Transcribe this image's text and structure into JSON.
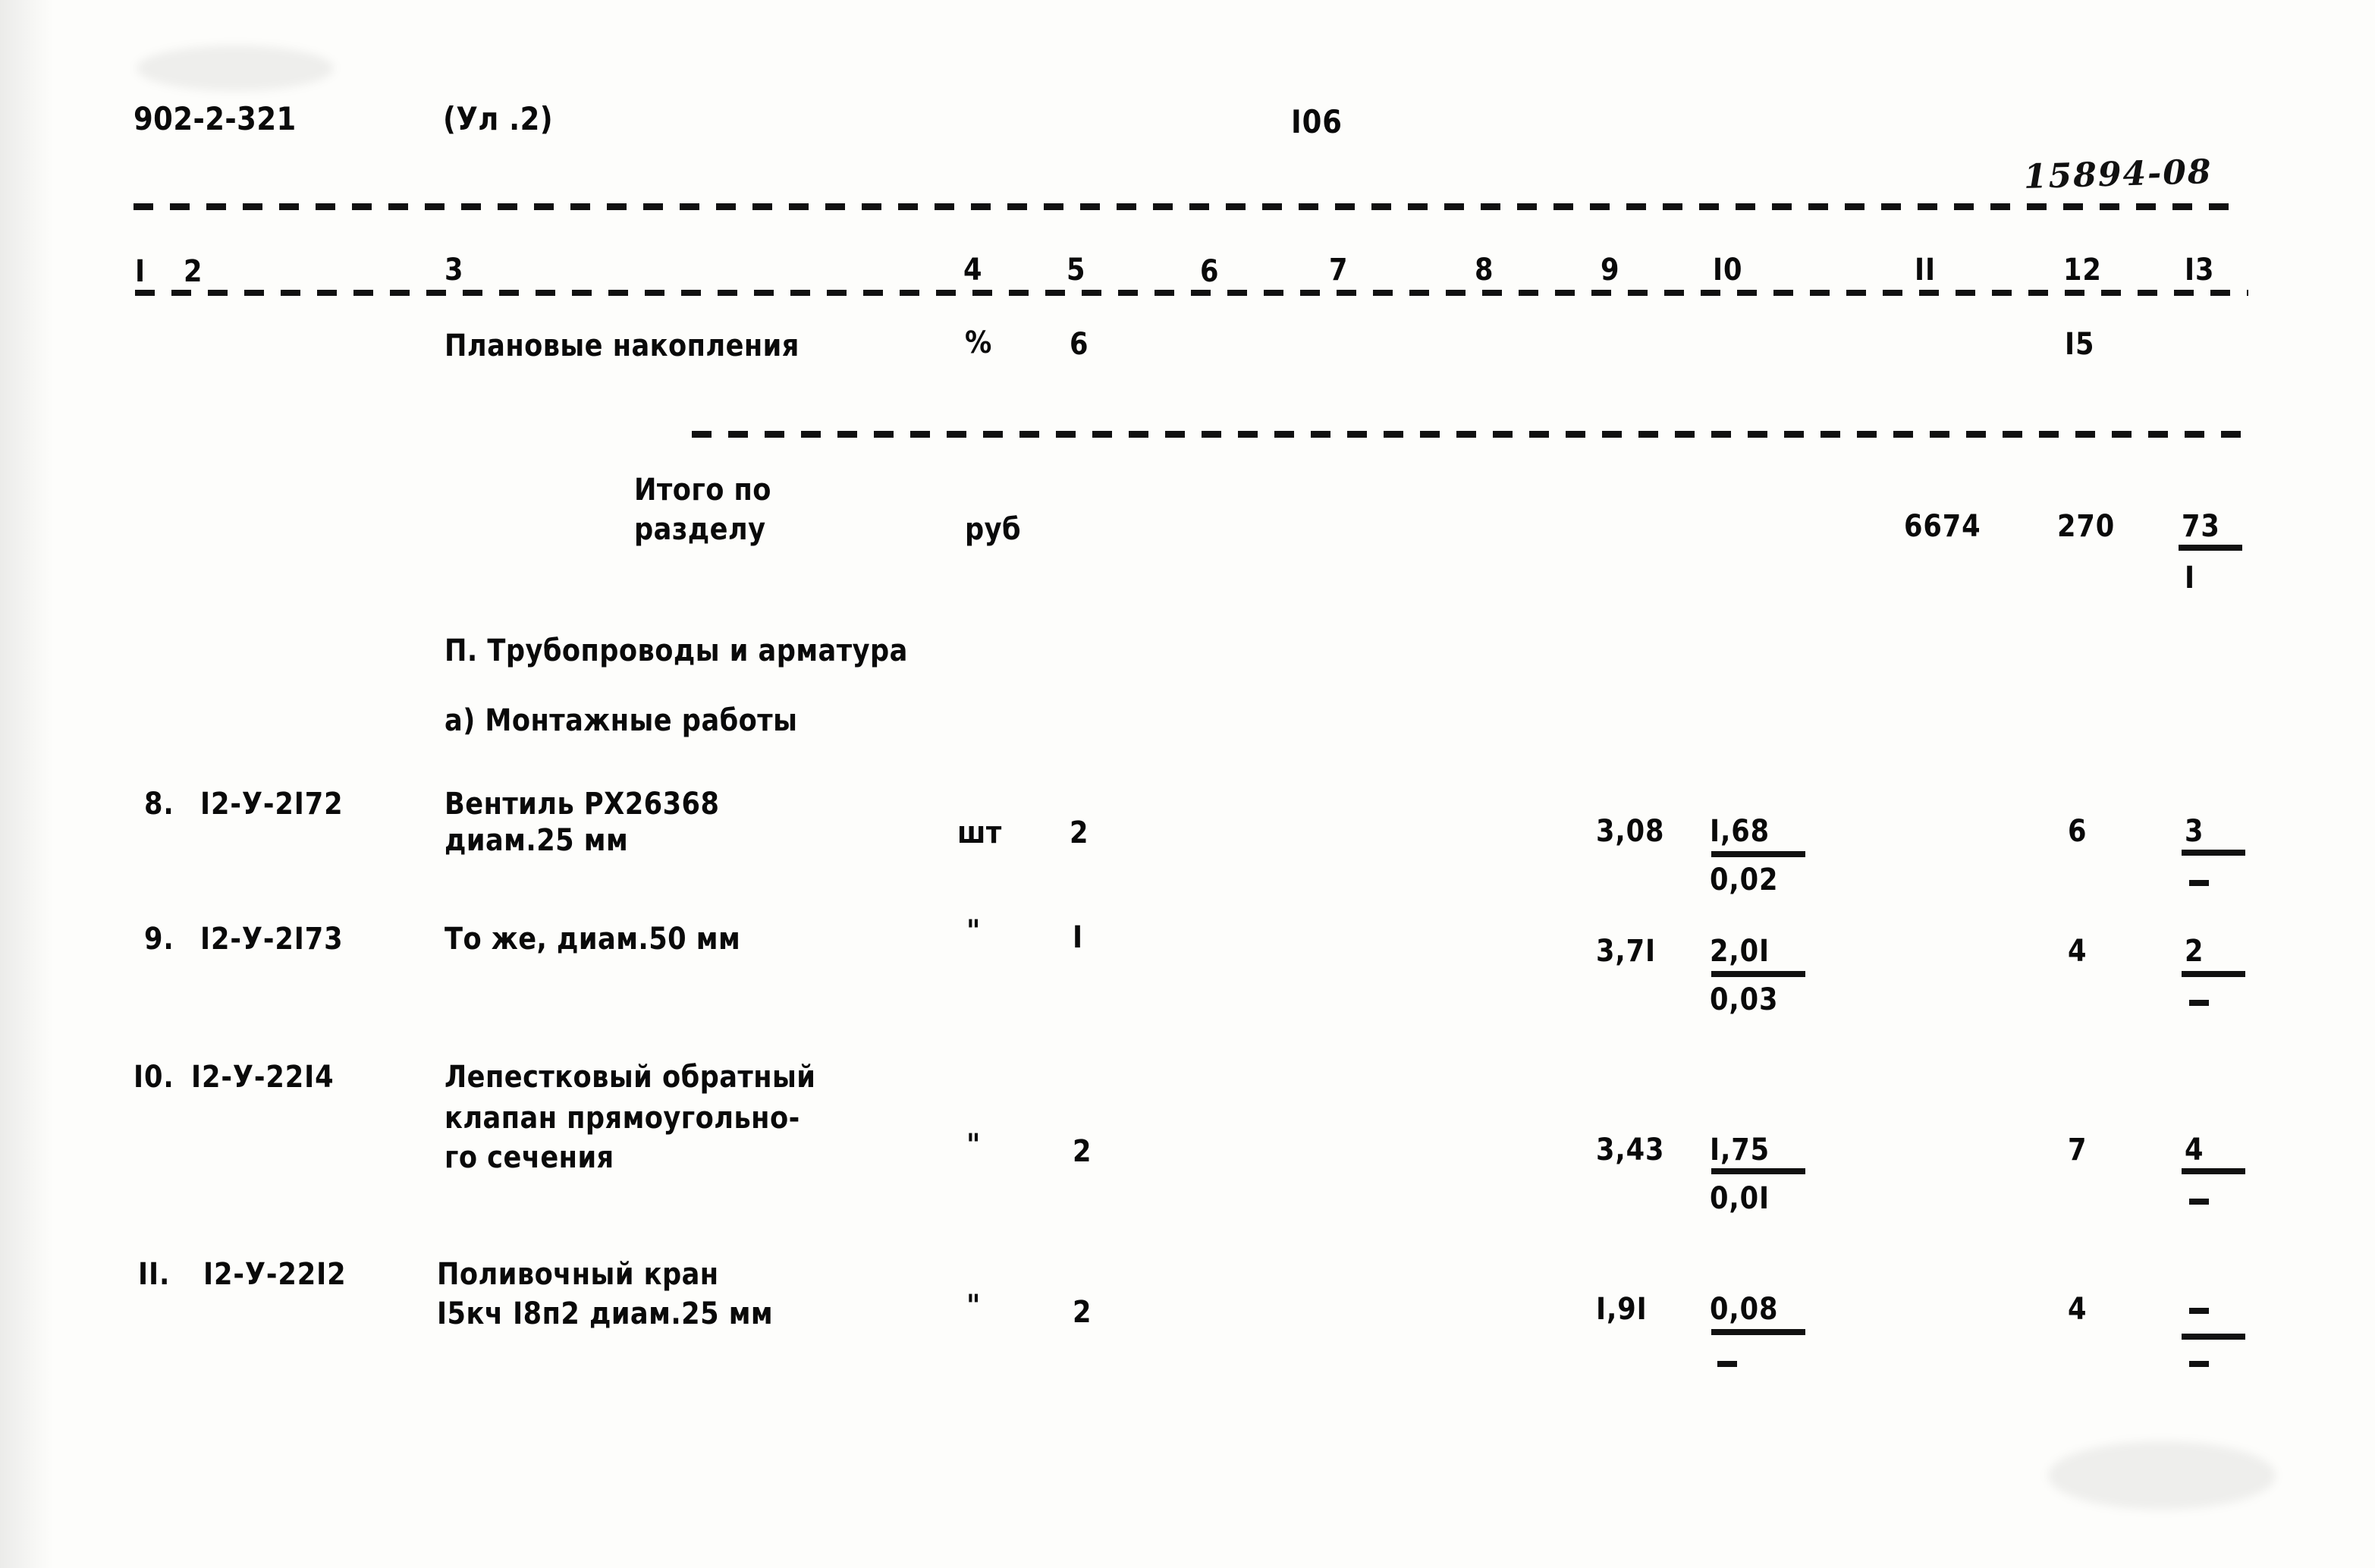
{
  "header": {
    "doc_code": "902-2-321",
    "sheet_ref": "(Ул .2)",
    "page_number": "I06",
    "stamp_number": "15894-08"
  },
  "column_headers": [
    "I",
    "2",
    "3",
    "4",
    "5",
    "6",
    "7",
    "8",
    "9",
    "I0",
    "II",
    "12",
    "I3"
  ],
  "rows": [
    {
      "name": "planned-savings",
      "no": "",
      "code": "",
      "desc_lines": [
        "Плановые накопления"
      ],
      "unit": "%",
      "qty": "6",
      "col9": "",
      "col10_top": "",
      "col10_bottom": "",
      "col11": "",
      "col12": "I5",
      "col13_top": "",
      "col13_bottom": ""
    },
    {
      "name": "section-total",
      "no": "",
      "code": "",
      "desc_lines": [
        "Итого по",
        "разделу"
      ],
      "unit": "руб",
      "qty": "",
      "col9": "",
      "col10_top": "",
      "col10_bottom": "",
      "col11": "6674",
      "col12": "270",
      "col13_top": "73",
      "col13_bottom": "I"
    },
    {
      "name": "item-8",
      "no": "8.",
      "code": "I2-У-2I72",
      "desc_lines": [
        "Вентиль РХ26368",
        "диам.25 мм"
      ],
      "unit": "шт",
      "qty": "2",
      "col9": "3,08",
      "col10_top": "I,68",
      "col10_bottom": "0,02",
      "col11": "",
      "col12": "6",
      "col13_top": "3",
      "col13_bottom": "-"
    },
    {
      "name": "item-9",
      "no": "9.",
      "code": "I2-У-2I73",
      "desc_lines": [
        "То же, диам.50 мм"
      ],
      "unit": "\"",
      "qty": "I",
      "col9": "3,7I",
      "col10_top": "2,0I",
      "col10_bottom": "0,03",
      "col11": "",
      "col12": "4",
      "col13_top": "2",
      "col13_bottom": "-"
    },
    {
      "name": "item-10",
      "no": "I0.",
      "code": "I2-У-22I4",
      "desc_lines": [
        "Лепестковый обратный",
        "клапан прямоугольно-",
        "го сечения"
      ],
      "unit": "\"",
      "qty": "2",
      "col9": "3,43",
      "col10_top": "I,75",
      "col10_bottom": "0,0I",
      "col11": "",
      "col12": "7",
      "col13_top": "4",
      "col13_bottom": "-"
    },
    {
      "name": "item-11",
      "no": "II.",
      "code": "I2-У-22I2",
      "desc_lines": [
        "Поливочный кран",
        "I5кч I8п2 диам.25 мм"
      ],
      "unit": "\"",
      "qty": "2",
      "col9": "I,9I",
      "col10_top": "0,08",
      "col10_bottom": "-",
      "col11": "",
      "col12": "4",
      "col13_top": "-",
      "col13_bottom": "-"
    }
  ],
  "sections": {
    "chapter_title": "П. Трубопроводы и арматура",
    "subsection_title": "а) Монтажные работы"
  }
}
